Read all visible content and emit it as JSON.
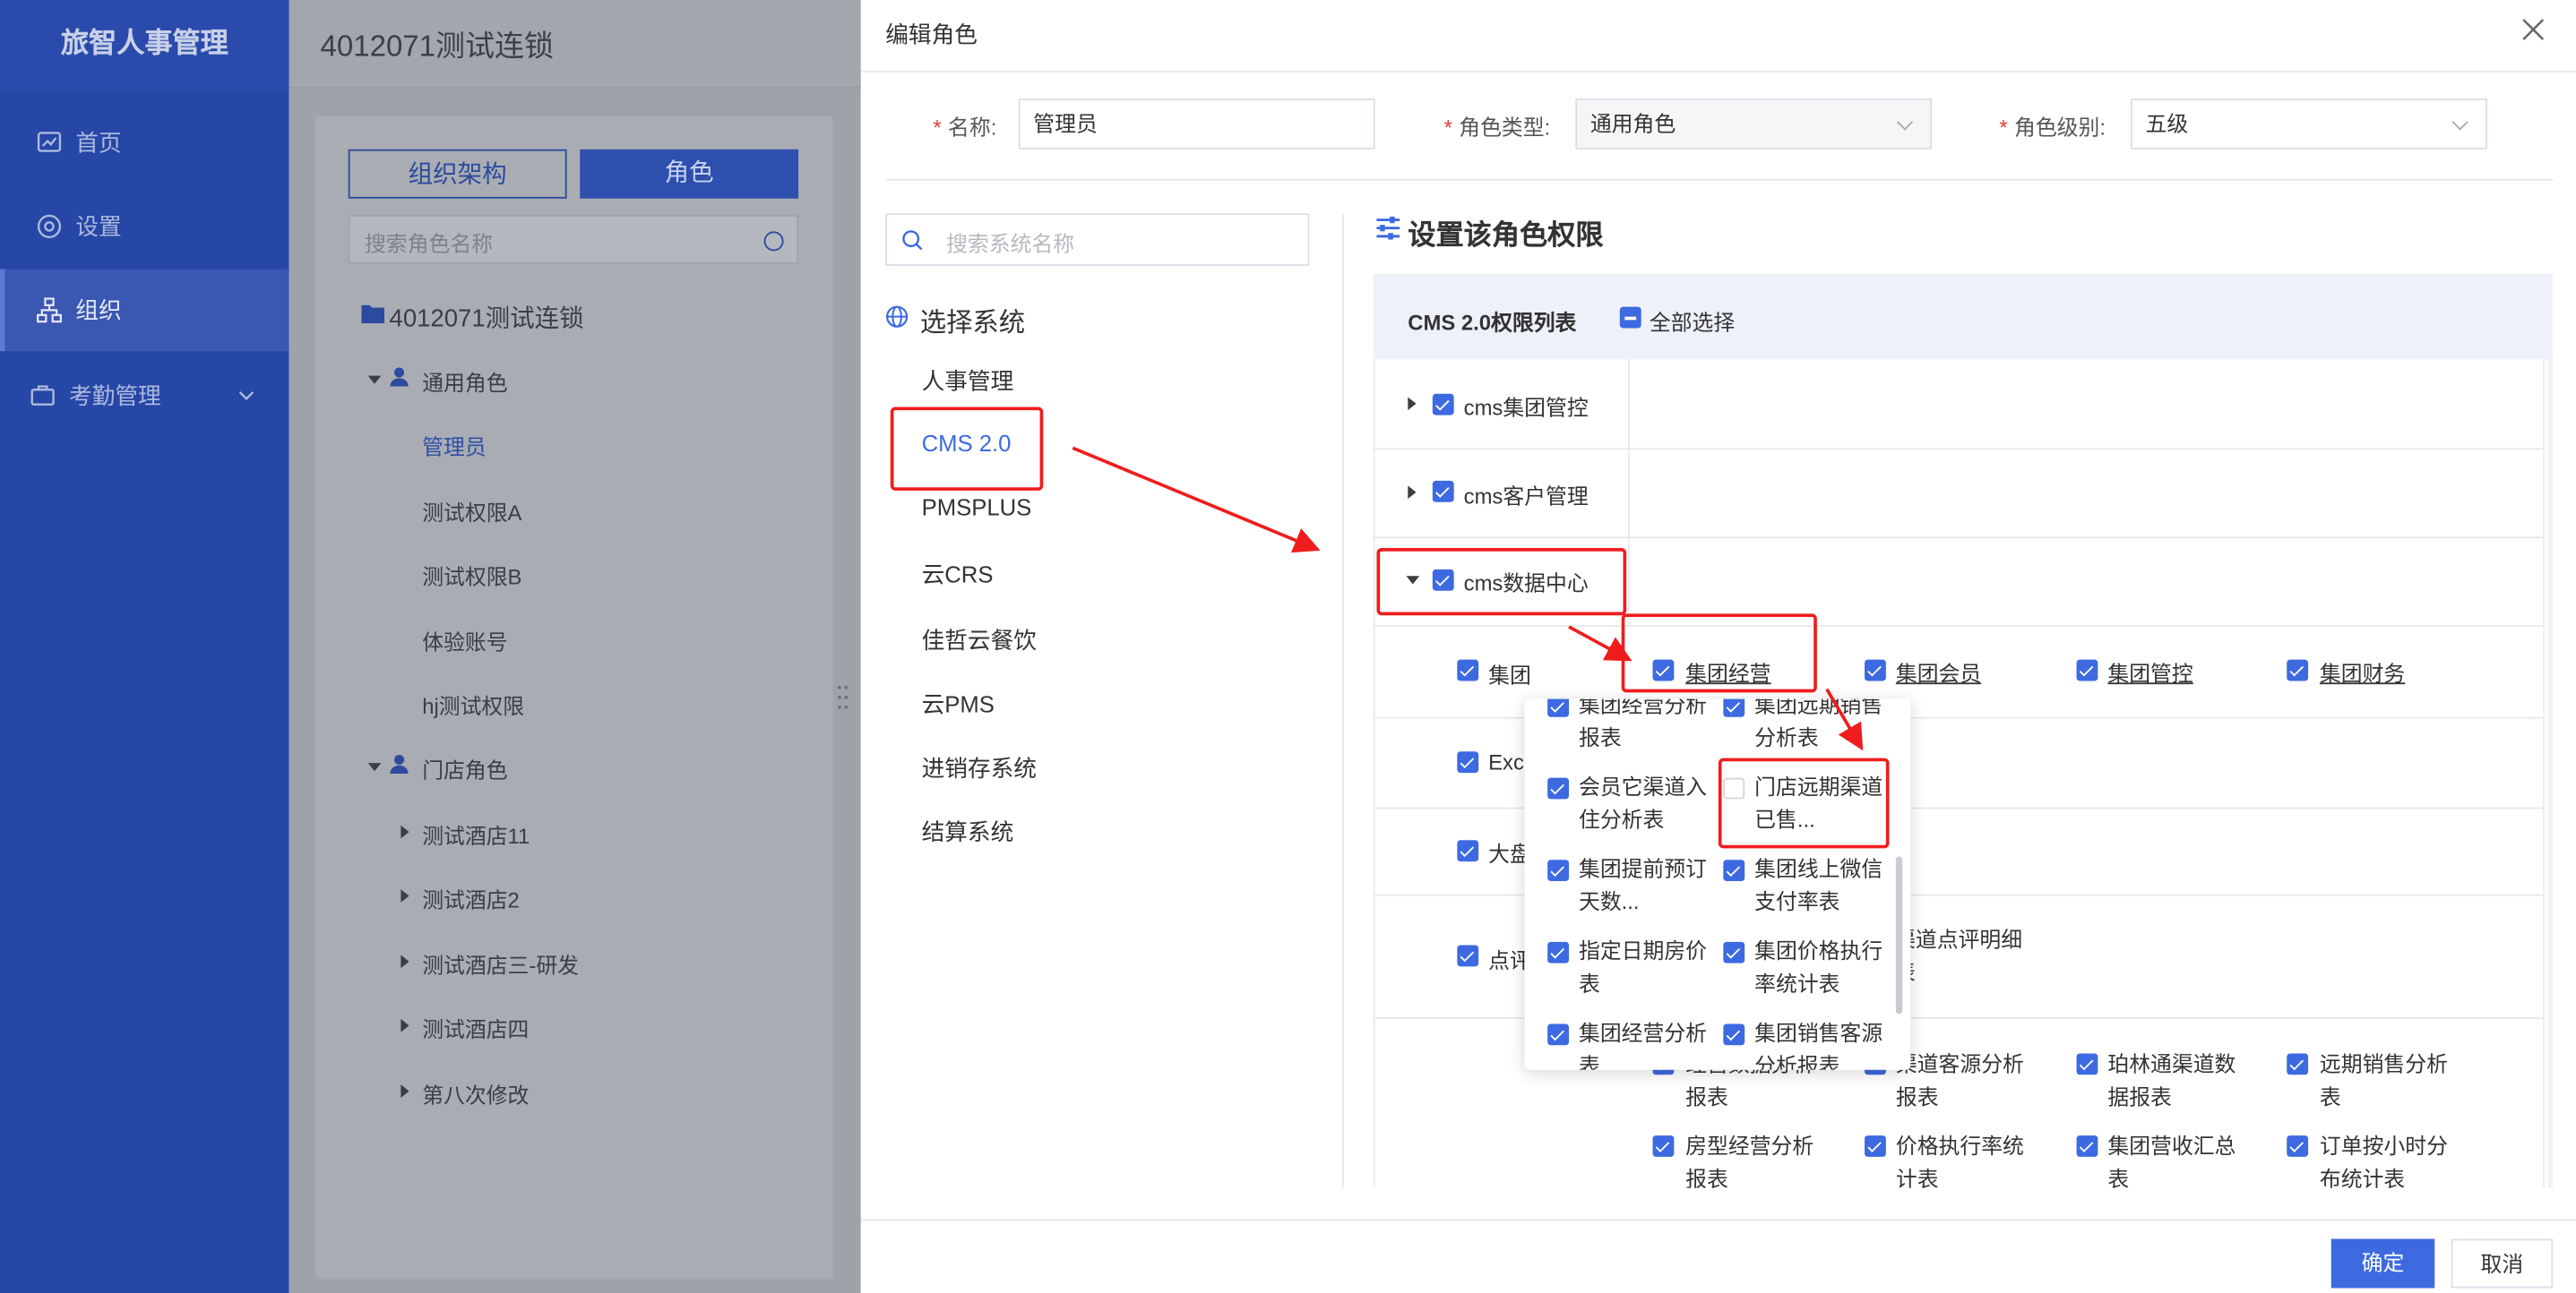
{
  "sidebar": {
    "logo": "旅智人事管理",
    "items": [
      {
        "label": "首页",
        "icon": "chart-board-icon"
      },
      {
        "label": "设置",
        "icon": "settings-circle-icon"
      },
      {
        "label": "组织",
        "icon": "org-tree-icon",
        "active": true
      },
      {
        "label": "考勤管理",
        "icon": "briefcase-icon",
        "has_submenu": true
      }
    ]
  },
  "org_panel": {
    "org_name": "4012071测试连锁",
    "tabs": [
      "组织架构",
      "角色"
    ],
    "search_placeholder": "搜索角色名称",
    "root": "4012071测试连锁",
    "group_general": "通用角色",
    "general_roles": [
      "管理员",
      "测试权限A",
      "测试权限B",
      "体验账号",
      "hj测试权限"
    ],
    "group_store": "门店角色",
    "store_roles": [
      "测试酒店11",
      "测试酒店2",
      "测试酒店三-研发",
      "测试酒店四",
      "第八次修改"
    ]
  },
  "modal": {
    "title": "编辑角色",
    "name_label": "名称:",
    "name_value": "管理员",
    "type_label": "角色类型:",
    "type_value": "通用角色",
    "level_label": "角色级别:",
    "level_value": "五级",
    "system_search_placeholder": "搜索系统名称",
    "select_system_title": "选择系统",
    "systems": [
      "人事管理",
      "CMS 2.0",
      "PMSPLUS",
      "云CRS",
      "佳哲云餐饮",
      "云PMS",
      "进销存系统",
      "结算系统"
    ],
    "selected_system": "CMS 2.0",
    "perm_title": "设置该角色权限",
    "perm_list_title": "CMS 2.0权限列表",
    "select_all": "全部选择",
    "modules": [
      "cms集团管控",
      "cms客户管理",
      "cms数据中心"
    ],
    "row_labels": [
      "集团",
      "Exc",
      "大盘",
      "点评"
    ],
    "group_row_items": [
      "集团经营",
      "集团会员",
      "集团管控",
      "集团财务"
    ],
    "popup_items": [
      {
        "label": "集团经营分析报表",
        "checked": true
      },
      {
        "label": "集团远期销售分析表",
        "checked": true
      },
      {
        "label": "会员它渠道入住分析表",
        "checked": true
      },
      {
        "label": "门店远期渠道已售...",
        "checked": false
      },
      {
        "label": "集团提前预订天数...",
        "checked": true
      },
      {
        "label": "集团线上微信支付率表",
        "checked": true
      },
      {
        "label": "指定日期房价表",
        "checked": true
      },
      {
        "label": "集团价格执行率统计表",
        "checked": true
      },
      {
        "label": "集团经营分析表",
        "checked": true
      },
      {
        "label": "集团销售客源分析报表",
        "checked": true
      }
    ],
    "partial_text": "渠道点评明细表",
    "bottom_rows": [
      [
        "经营数据分析报表",
        "渠道客源分析报表",
        "珀林通渠道数据报表",
        "远期销售分析表"
      ],
      [
        "房型经营分析报表",
        "价格执行率统计表",
        "集团营收汇总表",
        "订单按小时分布统计表"
      ]
    ],
    "confirm": "确定",
    "cancel": "取消"
  },
  "colors": {
    "sidebar": "#2747a6",
    "primary": "#3d6ae0",
    "annotation": "#ef1d1d"
  }
}
